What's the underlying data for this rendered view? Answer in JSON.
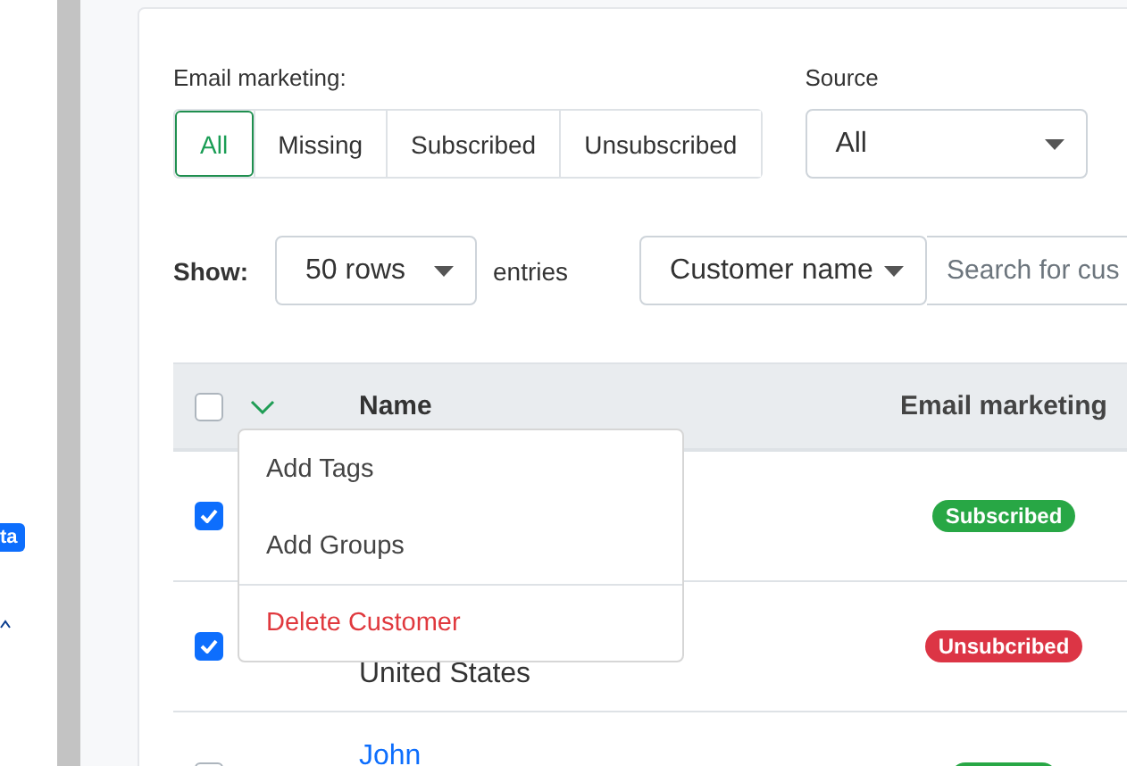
{
  "sidebar": {
    "badge": "ta"
  },
  "filters": {
    "email_label": "Email marketing:",
    "segments": [
      {
        "label": "All",
        "selected": true
      },
      {
        "label": "Missing",
        "selected": false
      },
      {
        "label": "Subscribed",
        "selected": false
      },
      {
        "label": "Unsubscribed",
        "selected": false
      }
    ],
    "source_label": "Source",
    "source_value": "All"
  },
  "show": {
    "label": "Show:",
    "value": "50 rows",
    "suffix": "entries"
  },
  "search": {
    "field": "Customer name",
    "placeholder": "Search for cus"
  },
  "table": {
    "all_checked": false,
    "columns": [
      "Name",
      "Email marketing"
    ],
    "rows": [
      {
        "checked": true,
        "email": {
          "label": "Subscribed",
          "kind": "subscribed"
        }
      },
      {
        "checked": true,
        "location": "United States",
        "email": {
          "label": "Unsubcribed",
          "kind": "unsubscribed"
        }
      },
      {
        "checked": false,
        "name": "John",
        "email": {
          "kind": "subscribed"
        }
      }
    ]
  },
  "menu": {
    "items": [
      {
        "label": "Add Tags",
        "kind": "normal"
      },
      {
        "label": "Add Groups",
        "kind": "normal"
      },
      {
        "label": "Delete Customer",
        "kind": "danger"
      }
    ]
  }
}
